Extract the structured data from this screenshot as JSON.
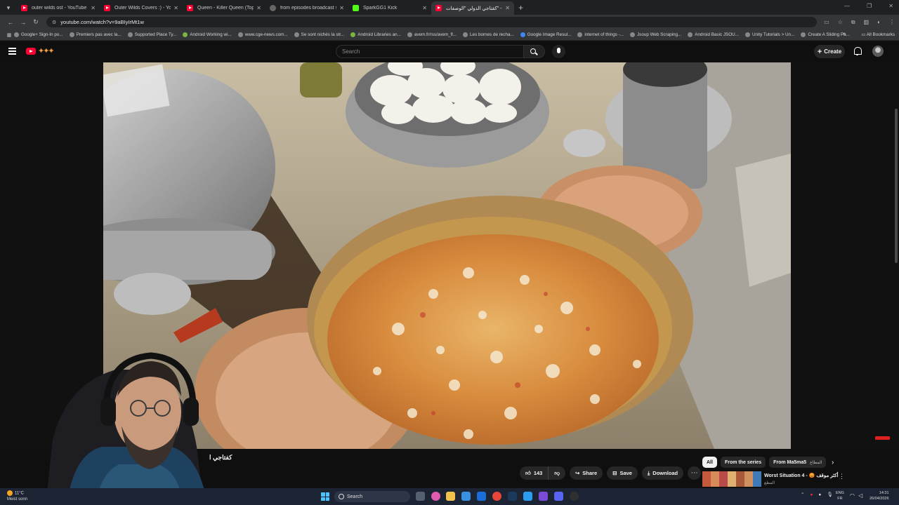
{
  "browser": {
    "tabs": [
      {
        "title": "outer wilds ost - YouTube",
        "icon": "youtube-icon",
        "active": false
      },
      {
        "title": "Outer Wilds Covers :) - YouTub",
        "icon": "youtube-icon",
        "active": false
      },
      {
        "title": "Queen - Killer Queen (Top Of Th",
        "icon": "youtube-icon",
        "active": false
      },
      {
        "title": "from episodes broadcast schedu",
        "icon": "globe-icon",
        "active": false
      },
      {
        "title": "SparkGG1 Kick",
        "icon": "kick-icon",
        "active": false
      },
      {
        "title": "كفتاجي الدولي \"الوصفات\" -",
        "icon": "youtube-icon",
        "active": true
      }
    ],
    "url": "youtube.com/watch?v=9aBIyIrMt1w",
    "bookmarks": [
      "Google+ Sign-In po...",
      "Premiers pas avec la...",
      "Supported Place Ty...",
      "Android Working wi...",
      "www.cge-news.com...",
      "Se sont nichés la str...",
      "Android Libraries an...",
      "avem.fr/rss/avem_fl...",
      "Les bornes de recha...",
      "Google Image Resul...",
      "internet of things -...",
      "Jsoup Web Scraping...",
      "Android Basic JSOU...",
      "Unity Tutorials > Un...",
      "Create A Sliding Pa..."
    ],
    "all_bookmarks": "All Bookmarks"
  },
  "youtube": {
    "search_placeholder": "Search",
    "create_label": "Create",
    "video_title": "كفتاجي ا",
    "actions": {
      "like_count": "143",
      "share": "Share",
      "save": "Save",
      "download": "Download"
    },
    "chips": [
      "All",
      "From the series",
      "From Ma5ma5"
    ],
    "chip_partial": "المطاع",
    "recommendation": {
      "title": "Worst Situation 4 - 😡 أكثر موقف",
      "channel": "المطع"
    }
  },
  "taskbar": {
    "weather_temp": "11°C",
    "weather_desc": "Meist sonn",
    "search_label": "Search",
    "lang_top": "ENG",
    "lang_bottom": "FR",
    "time": "14:31",
    "date": "26/04/2026"
  },
  "colors": {
    "youtube_red": "#ff0033",
    "page_bg": "#0f0f0f",
    "chip_bg": "#272727",
    "taskbar_bg": "#1c2433"
  }
}
